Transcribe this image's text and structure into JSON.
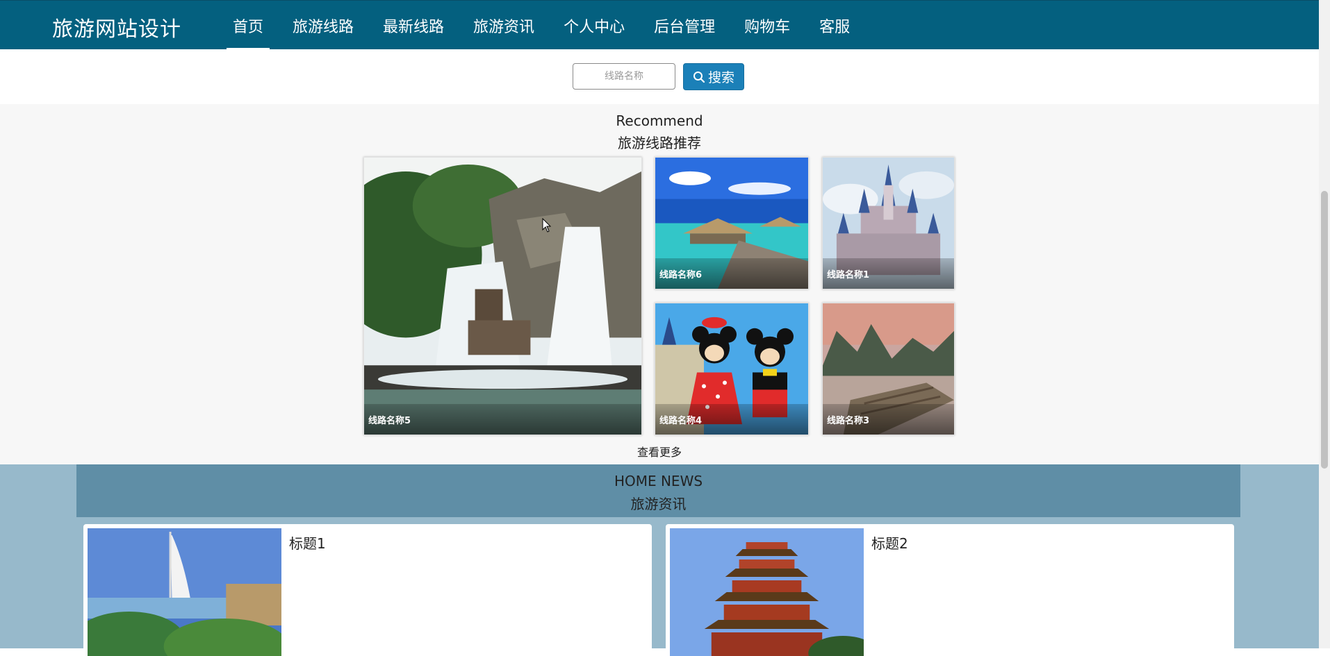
{
  "site": {
    "brand": "旅游网站设计"
  },
  "nav": [
    {
      "label": "首页",
      "active": true
    },
    {
      "label": "旅游线路",
      "active": false
    },
    {
      "label": "最新线路",
      "active": false
    },
    {
      "label": "旅游资讯",
      "active": false
    },
    {
      "label": "个人中心",
      "active": false
    },
    {
      "label": "后台管理",
      "active": false
    },
    {
      "label": "购物车",
      "active": false
    },
    {
      "label": "客服",
      "active": false
    }
  ],
  "search": {
    "placeholder": "线路名称",
    "value": "",
    "button_label": "搜索",
    "button_icon": "search-icon"
  },
  "recommend": {
    "title_en": "Recommend",
    "title_cn": "旅游线路推荐",
    "routes": [
      {
        "name": "线路名称5",
        "image": "waterfall-theme-park"
      },
      {
        "name": "线路名称6",
        "image": "ocean-pier-bungalows"
      },
      {
        "name": "线路名称1",
        "image": "fairytale-castle"
      },
      {
        "name": "线路名称4",
        "image": "mouse-mascots-castle"
      },
      {
        "name": "线路名称3",
        "image": "river-bamboo-raft"
      }
    ],
    "more_label": "查看更多"
  },
  "news": {
    "title_en": "HOME NEWS",
    "title_cn": "旅游资讯",
    "items": [
      {
        "title": "标题1",
        "image": "sail-hotel-resort"
      },
      {
        "title": "标题2",
        "image": "pagoda-tower"
      }
    ]
  },
  "colors": {
    "nav_bg": "#04607f",
    "search_button": "#1b80b8",
    "recommend_bg": "#f7f7f7",
    "news_bg": "#97b9cb",
    "news_header": "#5f8ea6"
  }
}
